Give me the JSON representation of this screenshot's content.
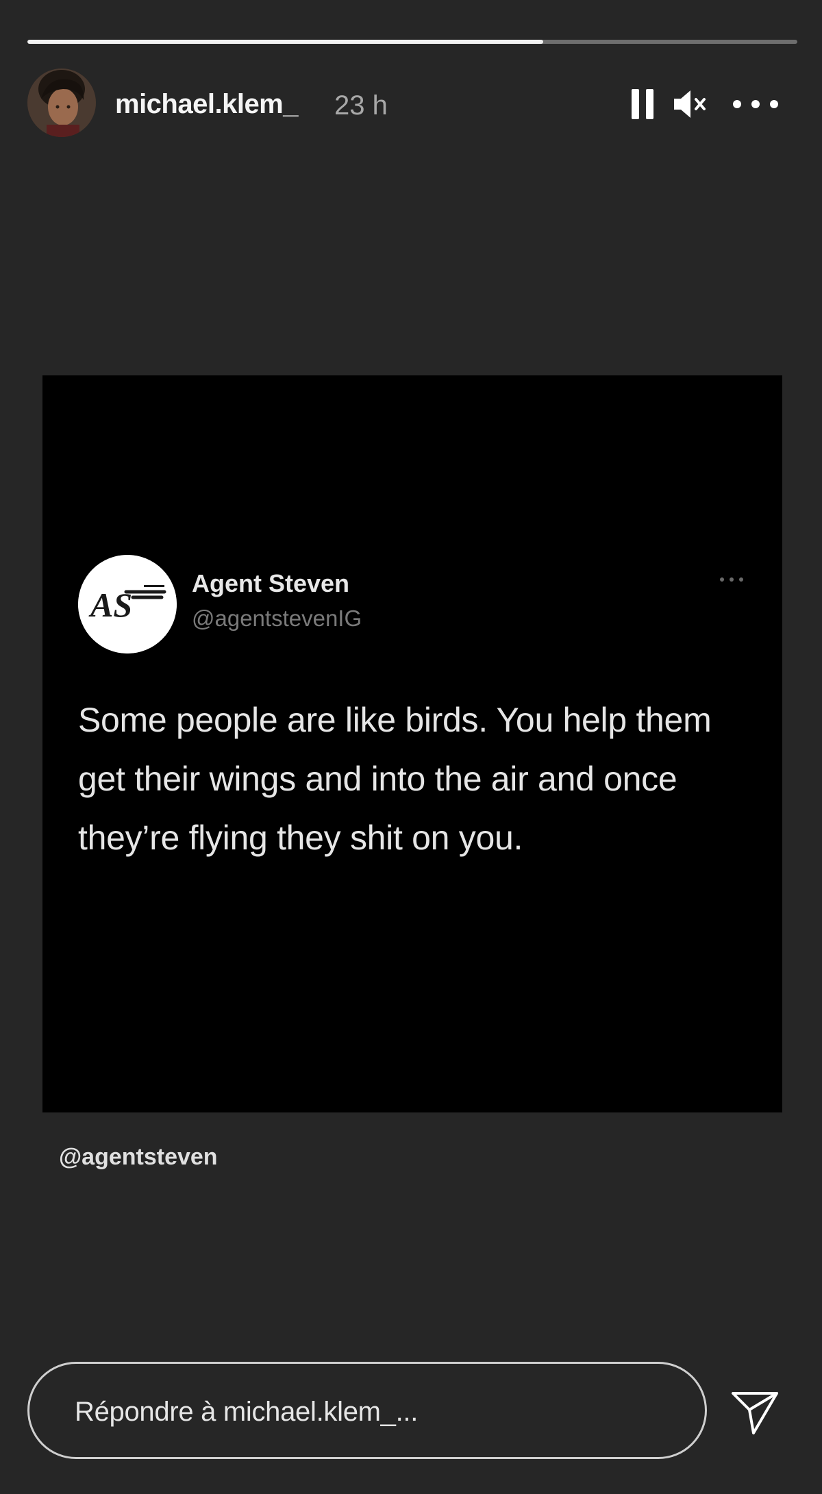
{
  "story": {
    "progress": 0.67,
    "username": "michael.klem_",
    "time": "23 h",
    "controls": {
      "pause_icon": "pause-icon",
      "mute_icon": "speaker-muted-icon",
      "more_icon": "more-horizontal-icon"
    }
  },
  "tweet": {
    "logo_text": "AS",
    "name": "Agent Steven",
    "handle": "@agentstevenIG",
    "more_icon": "more-horizontal-icon",
    "text": "Some people are like birds. You help them get their wings and into the air and once they’re flying they shit on you."
  },
  "mention": "@agentsteven",
  "reply": {
    "placeholder": "Répondre à michael.klem_...",
    "send_icon": "send-icon"
  },
  "colors": {
    "background": "#262626",
    "post_background": "#000000",
    "progress_fill": "#f2f2f2",
    "progress_track": "#6e6e6e"
  }
}
